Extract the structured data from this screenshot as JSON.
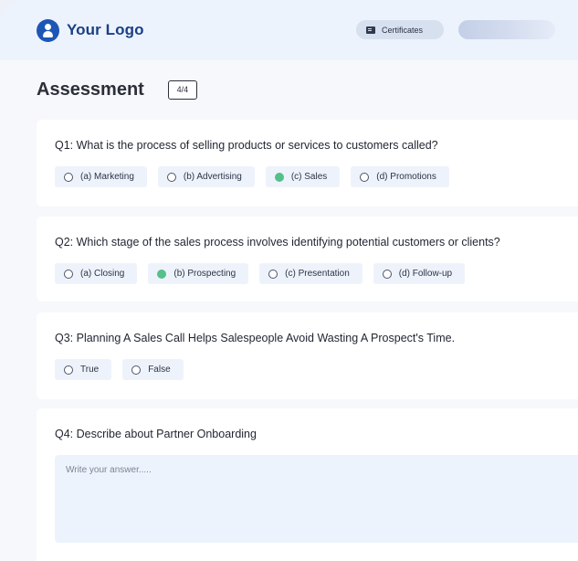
{
  "header": {
    "logo_text": "Your Logo",
    "certificates_label": "Certificates"
  },
  "page": {
    "title": "Assessment",
    "progress": "4/4"
  },
  "colors": {
    "brand": "#1d56b5",
    "selected": "#55c08a",
    "option_bg": "#eef3fb"
  },
  "questions": [
    {
      "text": "Q1: What is the process of selling products or services to customers called?",
      "options": [
        "(a) Marketing",
        "(b) Advertising",
        "(c) Sales",
        "(d) Promotions"
      ],
      "selected_index": 2
    },
    {
      "text": "Q2: Which stage of the sales process involves identifying potential customers or clients?",
      "options": [
        "(a) Closing",
        "(b) Prospecting",
        "(c) Presentation",
        "(d) Follow-up"
      ],
      "selected_index": 1
    },
    {
      "text": "Q3: Planning A Sales Call Helps Salespeople Avoid Wasting A Prospect's Time.",
      "options": [
        "True",
        "False"
      ],
      "selected_index": -1
    },
    {
      "text": "Q4: Describe about Partner Onboarding",
      "answer_value": "",
      "answer_placeholder": "Write your answer....."
    }
  ]
}
